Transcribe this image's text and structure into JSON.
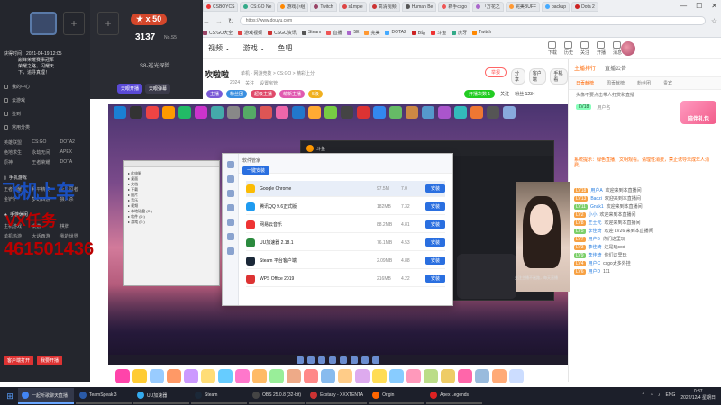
{
  "browser": {
    "tabs": [
      "CSBOYCS",
      "CS:GO Ne",
      "游戏小组",
      "Twitch",
      "s1mple",
      "高清视频",
      "Human Be",
      "新手csgo",
      "「万花之",
      "完美BUFF",
      "backup",
      "Dota 2"
    ],
    "address": "https://www.douyu.com",
    "bookmarks": [
      "CS:GO大全",
      "游戏视频",
      "CSGO资讯",
      "Steam",
      "直播",
      "5E",
      "完美",
      "DOTA2",
      "B站",
      "斗鱼",
      "虎牙",
      "Twitch"
    ]
  },
  "site_nav": {
    "items": [
      "视频",
      "游戏",
      "鱼吧"
    ],
    "actions": [
      "下载",
      "历史",
      "关注",
      "开播",
      "消息"
    ]
  },
  "room": {
    "title": "吹啦啦",
    "sub": "单机 · 网游竞技 > CS:GO > 精彩上分",
    "meta": [
      "2024",
      "关注",
      "设置房管"
    ],
    "badges": [
      "主播",
      "粉丝团",
      "超级主播",
      "萌新主播",
      "5级"
    ],
    "report": "举报",
    "share": [
      "分享",
      "客户端",
      "手机看"
    ],
    "follow": "关注",
    "heat": "开播次数 1",
    "fans": "粉丝 1234"
  },
  "left_panel": {
    "time": "获得时间：2021-04-19 12:05",
    "info_lines": [
      "巅峰荣耀赛事冠军",
      "荣耀之路，闪耀天",
      "下，追寻真理！"
    ],
    "menu": [
      "我的中心",
      "云游戏",
      "签到",
      "常用分类"
    ],
    "grid": [
      "英雄联盟",
      "CS:GO",
      "DOTA2",
      "绝地求生",
      "永劫无间",
      "APEX",
      "原神",
      "王者荣耀",
      "DOTA"
    ],
    "section1": "手机游戏",
    "grid2": [
      "王者荣耀",
      "和平精英",
      "火影忍者",
      "金铲铲",
      "梦幻西游",
      "狼人杀"
    ],
    "section2": "手游休闲",
    "grid3": [
      "主机游戏",
      "桌游",
      "棋牌",
      "单机热游",
      "大话西游",
      "我的世界"
    ],
    "bottom_buttons": [
      "客户端打开",
      "我要开播"
    ]
  },
  "profile": {
    "level": "★ x 50",
    "number": "3137",
    "sub": "No.S5",
    "rank": "S8-巡光探险",
    "buttons": [
      "天眼开播",
      "天眼弹幕"
    ]
  },
  "overlay": {
    "line1": "飞机上车",
    "line2": "VX任务",
    "line3": "461501436"
  },
  "stream_window": {
    "mgr_title": "软件管家",
    "mgr_button": "一键安装",
    "apps": [
      {
        "name": "Google Chrome",
        "size": "97.5M",
        "ver": "7.0",
        "action": "安装"
      },
      {
        "name": "腾讯QQ 9.6正式版",
        "size": "182MB",
        "ver": "7.32",
        "action": "安装"
      },
      {
        "name": "网易云音乐",
        "size": "88.2MB",
        "ver": "4.81",
        "action": "安装"
      },
      {
        "name": "UU加速器 2.18.1",
        "size": "76.1MB",
        "ver": "4.53",
        "action": "安装"
      },
      {
        "name": "Steam 平台客户端",
        "size": "2.09MB",
        "ver": "4.88",
        "action": "安装"
      },
      {
        "name": "WPS Office 2019",
        "size": "216MB",
        "ver": "4.22",
        "action": "安装"
      }
    ],
    "dark_title": "斗鱼",
    "cam_caption": "关注主播不迷路，每天直播"
  },
  "right_panel": {
    "tabs": [
      "主播排行",
      "直播公告"
    ],
    "subtabs": [
      "日贡献榜",
      "周贡献榜",
      "粉丝团",
      "贵宾"
    ],
    "notice": "头像不要点击带人打赏和直播",
    "rank": {
      "lvl": "LV18",
      "name": "用户名"
    },
    "gift_ad": "陪伴礼包",
    "messages": [
      {
        "type": "sys",
        "text": "系统提示：绿色直播，文明观看。请理性消费，禁止诱导未成年人消费。"
      },
      {
        "type": "chat",
        "tag": "LV18",
        "user": "用户A",
        "text": "欢迎来到本直播间"
      },
      {
        "type": "chat",
        "tag": "LV13",
        "user": "Baozi",
        "text": "欢迎来到本直播间"
      },
      {
        "type": "chat",
        "tag": "LV11",
        "user": "Gnak1",
        "text": "欢迎来到本直播间"
      },
      {
        "type": "chat",
        "tag": "LV2",
        "user": "小小",
        "text": "欢迎来到本直播间"
      },
      {
        "type": "chat",
        "tag": "LV8",
        "user": "王士元",
        "text": "欢迎来到本直播间"
      },
      {
        "type": "chat",
        "tag": "LV5",
        "user": "李佳琦",
        "text": "欢迎 LV26 来到本直播间"
      },
      {
        "type": "chat",
        "tag": "LV7",
        "user": "用户B",
        "text": "你们这里玩"
      },
      {
        "type": "chat",
        "tag": "LV3",
        "user": "李佳琦",
        "text": "还是玩cod"
      },
      {
        "type": "chat",
        "tag": "LV9",
        "user": "李佳琦",
        "text": "你们这里玩"
      },
      {
        "type": "chat",
        "tag": "LV4",
        "user": "用户C",
        "text": "csgo太多外挂"
      },
      {
        "type": "chat",
        "tag": "LV6",
        "user": "用户D",
        "text": "111"
      }
    ]
  },
  "taskbar": {
    "items": [
      "一起听歌聊天直播",
      "TeamSpeak 3",
      "UU加速器",
      "Steam",
      "OBS 25.0.8 (32-bit)",
      "Ecstasy - XXXTENTA",
      "Origin",
      "Apex Legends"
    ],
    "lang": "ENG",
    "time": "0:37",
    "date": "2022/12/4 星期日"
  }
}
